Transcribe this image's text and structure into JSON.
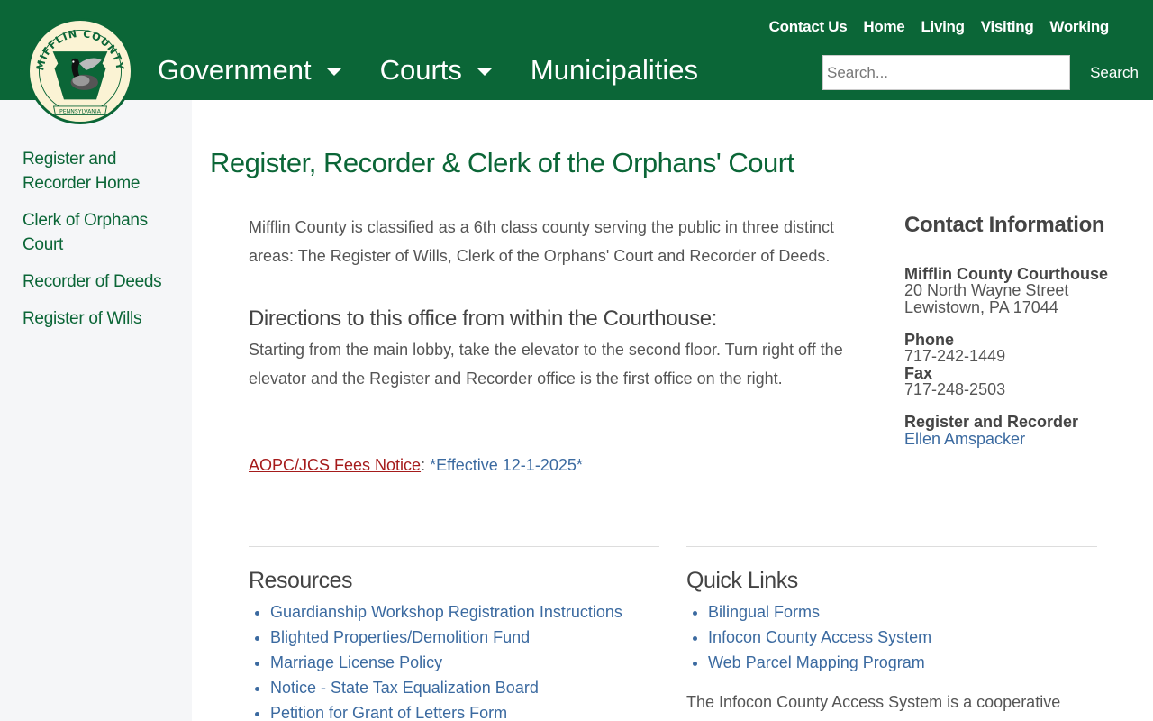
{
  "header": {
    "logo_text": "MIFFLIN COUNTY",
    "logo_banner": "PENNSYLVANIA",
    "utility_nav": [
      "Contact Us",
      "Home",
      "Living",
      "Visiting",
      "Working"
    ],
    "main_nav": {
      "government": "Government",
      "courts": "Courts",
      "municipalities": "Municipalities"
    },
    "search": {
      "placeholder": "Search...",
      "button": "Search"
    },
    "colors": {
      "brand_green": "#0b6637"
    }
  },
  "sidebar": {
    "items": [
      {
        "label": "Register and Recorder Home"
      },
      {
        "label": "Clerk of Orphans Court"
      },
      {
        "label": "Recorder of Deeds"
      },
      {
        "label": "Register of Wills"
      }
    ]
  },
  "main": {
    "title": "Register, Recorder & Clerk of the Orphans' Court",
    "intro": "Mifflin County is classified as a 6th class county serving the public in three distinct areas: The Register of Wills, Clerk of the Orphans' Court and Recorder of Deeds.",
    "directions_heading": "Directions to this office from within the Courthouse:",
    "directions_text": "Starting from the main lobby, take the elevator to the second floor. Turn right off the elevator and the Register and Recorder office is the first office on the right.",
    "fees_link": "AOPC/JCS Fees Notice",
    "fees_colon": ": ",
    "fees_effective": "*Effective 12-1-2025*"
  },
  "contact": {
    "heading": "Contact Information",
    "location_name": "Mifflin County Courthouse",
    "address_line1": "20 North Wayne Street",
    "address_line2": "Lewistown, PA 17044",
    "phone_label": "Phone",
    "phone": "717-242-1449",
    "fax_label": "Fax",
    "fax": "717-248-2503",
    "official_label": "Register and Recorder",
    "official_name": "Ellen Amspacker"
  },
  "resources": {
    "heading": "Resources",
    "items": [
      "Guardianship Workshop Registration Instructions",
      "Blighted Properties/Demolition Fund",
      "Marriage License Policy",
      "Notice - State Tax Equalization Board",
      "Petition for Grant of Letters Form"
    ]
  },
  "quick_links": {
    "heading": "Quick Links",
    "items": [
      "Bilingual Forms",
      "Infocon County Access System",
      "Web Parcel Mapping Program"
    ],
    "text": "The Infocon County Access System is a cooperative"
  }
}
